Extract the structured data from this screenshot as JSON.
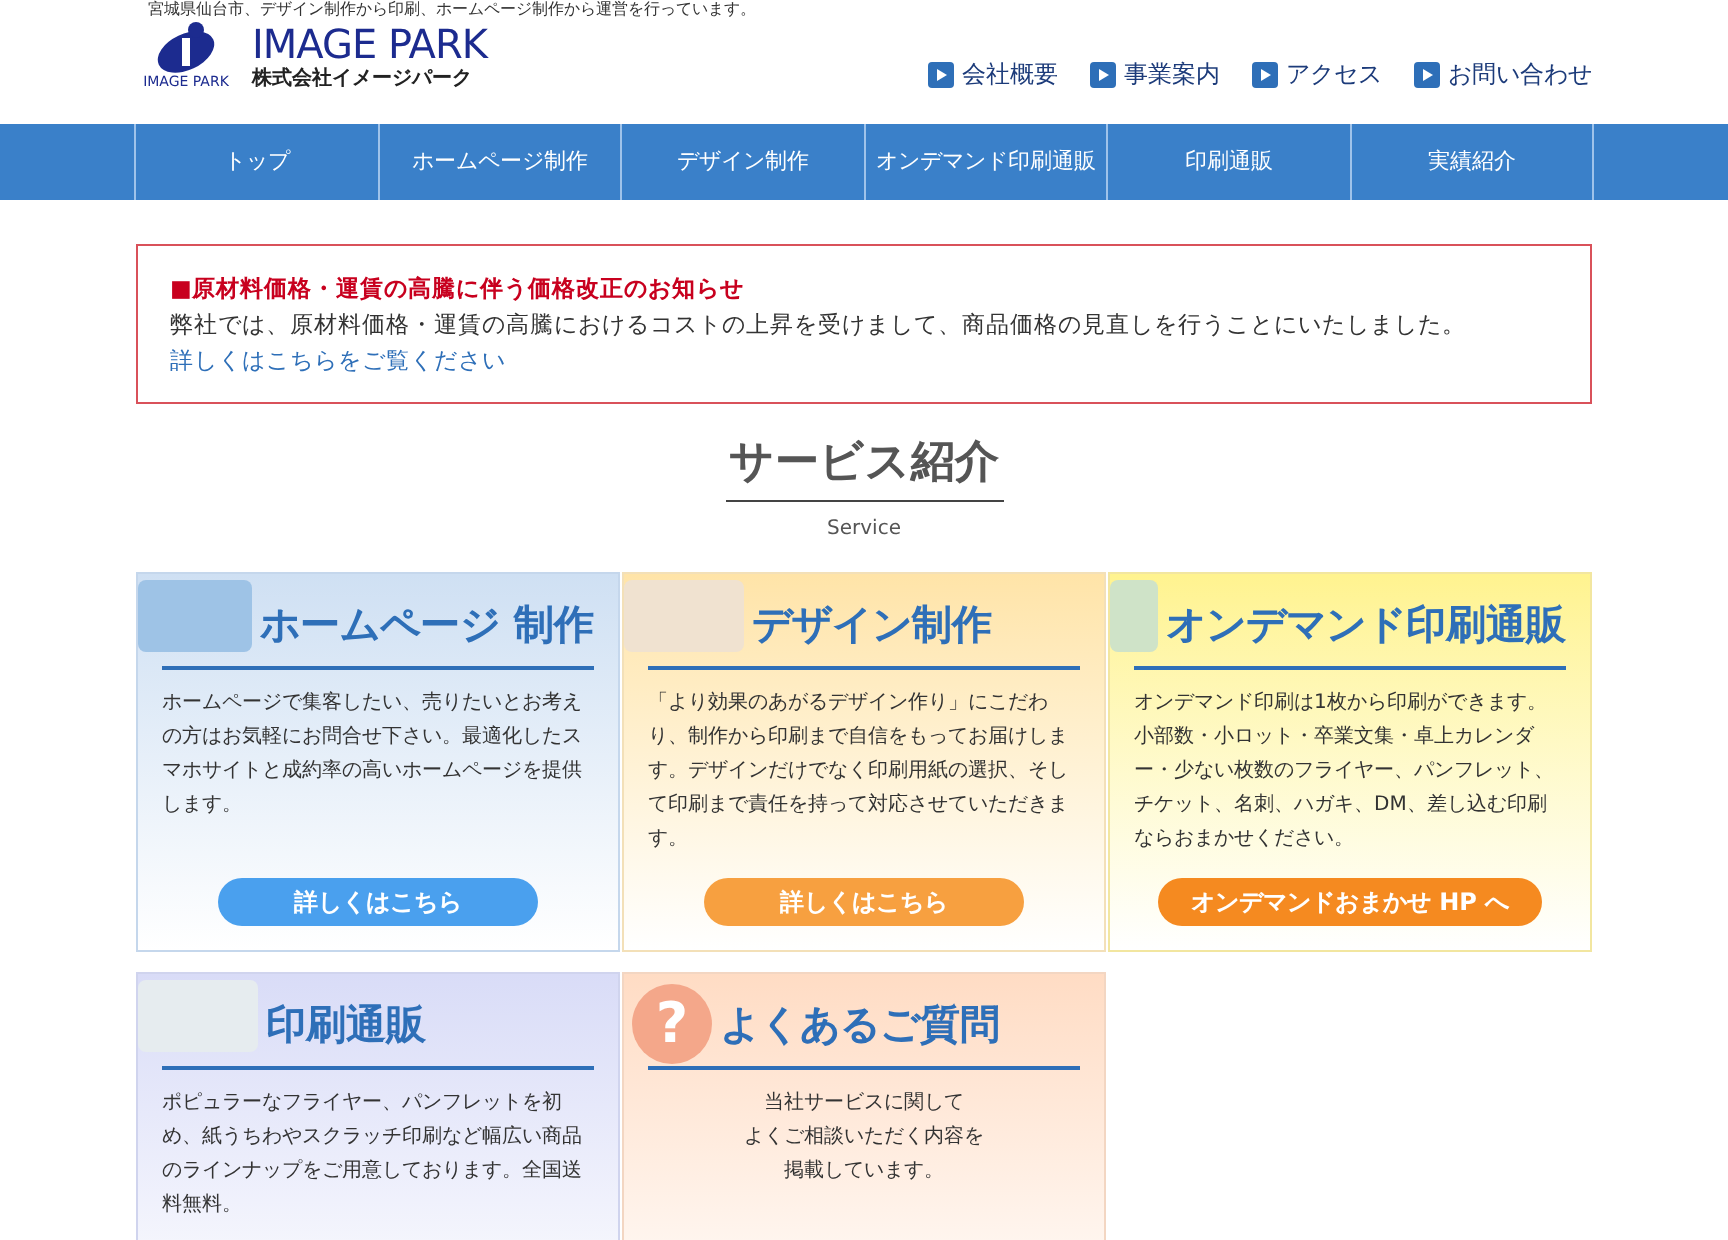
{
  "tagline": "宮城県仙台市、デザイン制作から印刷、ホームページ制作から運営を行っています。",
  "logo": {
    "mark_text": "IMAGE PARK",
    "name": "IMAGE PARK",
    "company": "株式会社イメージパーク"
  },
  "header_links": [
    "会社概要",
    "事業案内",
    "アクセス",
    "お問い合わせ"
  ],
  "nav": [
    "トップ",
    "ホームページ制作",
    "デザイン制作",
    "オンデマンド印刷通販",
    "印刷通販",
    "実績紹介"
  ],
  "notice": {
    "title": "■原材料価格・運賃の高騰に伴う価格改正のお知らせ",
    "body": "弊社では、原材料価格・運賃の高騰におけるコストの上昇を受けまして、商品価格の見直しを行うことにいたしました。",
    "link": "詳しくはこちらをご覧ください"
  },
  "section": {
    "title": "サービス紹介",
    "subtitle": "Service"
  },
  "cards": [
    {
      "kind": "web",
      "title": "ホームページ 制作",
      "body": [
        "ホームページで集客したい、売りたいとお考えの方はお気軽にお問合せ下さい。最適化したスマホサイトと成約率の高いホームページを提供します。"
      ],
      "button": "詳しくはこちら"
    },
    {
      "kind": "design",
      "title": "デザイン制作",
      "body": [
        "「より効果のあがるデザイン作り」にこだわり、制作から印刷まで自信をもってお届けします。デザインだけでなく印刷用紙の選択、そして印刷まで責任を持って対応させていただきます。"
      ],
      "button": "詳しくはこちら"
    },
    {
      "kind": "ondemand",
      "title": "オンデマンド印刷通販",
      "body": [
        "オンデマンド印刷は1枚から印刷ができます。小部数・小ロット・卒業文集・卓上カレンダー・少ない枚数のフライヤー、パンフレット、チケット、名刺、ハガキ、DM、差し込む印刷ならおまかせください。"
      ],
      "button": "オンデマンドおまかせ HP へ"
    },
    {
      "kind": "print",
      "title": "印刷通販",
      "body": [
        "ポピュラーなフライヤー、パンフレットを初め、紙うちわやスクラッチ印刷など幅広い商品のラインナップをご用意しております。全国送料無料。"
      ]
    },
    {
      "kind": "faq",
      "title": "よくあるご質問",
      "icon_text": "?",
      "body": [
        "当社サービスに関して",
        "よくご相談いただく内容を",
        "掲載しています。"
      ]
    }
  ]
}
